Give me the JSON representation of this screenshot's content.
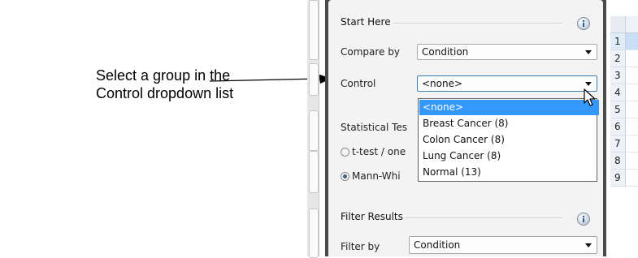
{
  "annotation": {
    "lines": [
      "Select a group in the",
      "Control dropdown list"
    ]
  },
  "start_section": {
    "title": "Start Here"
  },
  "compare_by": {
    "label": "Compare by",
    "value": "Condition"
  },
  "control": {
    "label": "Control",
    "value": "<none>"
  },
  "statistical_test": {
    "label": "Statistical Tes"
  },
  "radios": [
    {
      "label": "t-test / one",
      "selected": false
    },
    {
      "label": "Mann-Whi",
      "selected": true
    }
  ],
  "dropdown": {
    "options": [
      "<none>",
      "Breast Cancer (8)",
      "Colon Cancer (8)",
      "Lung Cancer (8)",
      "Normal (13)"
    ],
    "highlighted_index": 0
  },
  "filter_section": {
    "title": "Filter Results"
  },
  "filter_by": {
    "label": "Filter by",
    "value": "Condition"
  },
  "grid": {
    "row_numbers": [
      "1",
      "2",
      "3",
      "4",
      "5",
      "6",
      "7",
      "8",
      "9"
    ]
  },
  "colors": {
    "highlight": "#3399ff",
    "panel_frame": "#4a4a4a",
    "focus_border": "#3c7fb1"
  },
  "icons": [
    "info-icon",
    "arrow-icon",
    "mouse-cursor-icon",
    "chevron-down-icon",
    "radio-icon"
  ]
}
